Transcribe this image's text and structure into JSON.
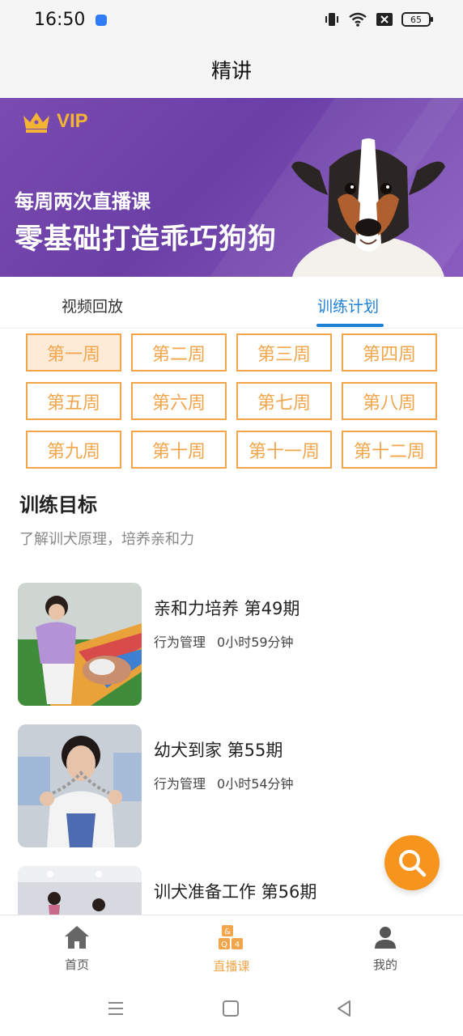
{
  "status": {
    "time": "16:50",
    "battery": "65"
  },
  "nav": {
    "title": "精讲"
  },
  "banner": {
    "vip_label": "VIP",
    "subtitle": "每周两次直播课",
    "headline": "零基础打造乖巧狗狗"
  },
  "tabs": {
    "video": "视频回放",
    "plan": "训练计划"
  },
  "weeks": [
    "第一周",
    "第二周",
    "第三周",
    "第四周",
    "第五周",
    "第六周",
    "第七周",
    "第八周",
    "第九周",
    "第十周",
    "第十一周",
    "第十二周"
  ],
  "goal": {
    "title": "训练目标",
    "desc": "了解训犬原理，培养亲和力"
  },
  "courses": [
    {
      "title": "亲和力培养 第49期",
      "category": "行为管理",
      "duration": "0小时59分钟"
    },
    {
      "title": "幼犬到家 第55期",
      "category": "行为管理",
      "duration": "0小时54分钟"
    },
    {
      "title": "训犬准备工作 第56期"
    }
  ],
  "tabbar": {
    "home": "首页",
    "live": "直播课",
    "mine": "我的"
  },
  "colors": {
    "accent_orange": "#f2a54a",
    "tab_blue": "#1e7fd6",
    "banner_purple": "#6a3fa6"
  }
}
